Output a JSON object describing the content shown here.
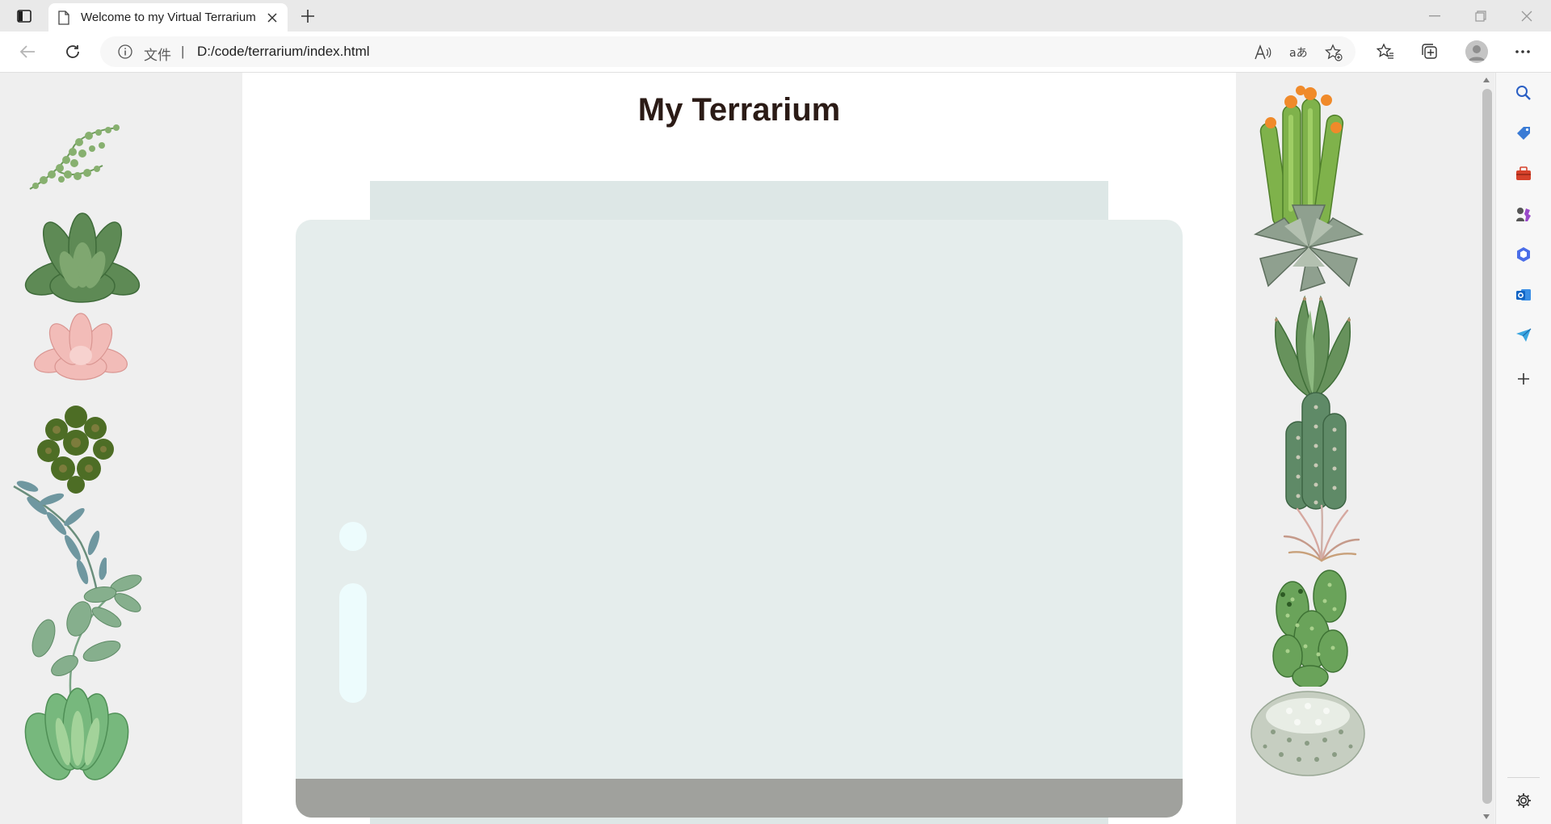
{
  "browser": {
    "tab": {
      "title": "Welcome to my Virtual Terrarium"
    },
    "address": {
      "file_label": "文件",
      "separator": "|",
      "url": "D:/code/terrarium/index.html"
    }
  },
  "page": {
    "title": "My Terrarium"
  },
  "icons": {
    "titlebar": [
      "sidebar-toggle-icon",
      "page-icon",
      "close-icon",
      "plus-icon",
      "minimize-icon",
      "restore-icon",
      "close-window-icon"
    ],
    "toolbar": [
      "back-arrow-icon",
      "refresh-icon",
      "info-icon",
      "read-aloud-icon",
      "translate-icon",
      "add-favorite-icon",
      "favorites-icon",
      "collections-icon",
      "profile-icon",
      "more-icon"
    ],
    "edge_sidebar": [
      "search-icon",
      "shopping-tag-icon",
      "tools-icon",
      "games-icon",
      "microsoft-365-icon",
      "outlook-icon",
      "send-icon",
      "add-icon",
      "settings-icon"
    ]
  },
  "colors": {
    "title": "#2b1b16",
    "jar_body": "#e5edec",
    "jar_top": "#dde7e6",
    "dirt": "#a0a19d",
    "glossy": "#edfcfd",
    "side_panel": "#efefef"
  },
  "plants": {
    "left": [
      "plant-1",
      "plant-2",
      "plant-3",
      "plant-4",
      "plant-5",
      "plant-6",
      "plant-7"
    ],
    "right": [
      "plant-8",
      "plant-9",
      "plant-10",
      "plant-11",
      "plant-12",
      "plant-13",
      "plant-14"
    ]
  }
}
